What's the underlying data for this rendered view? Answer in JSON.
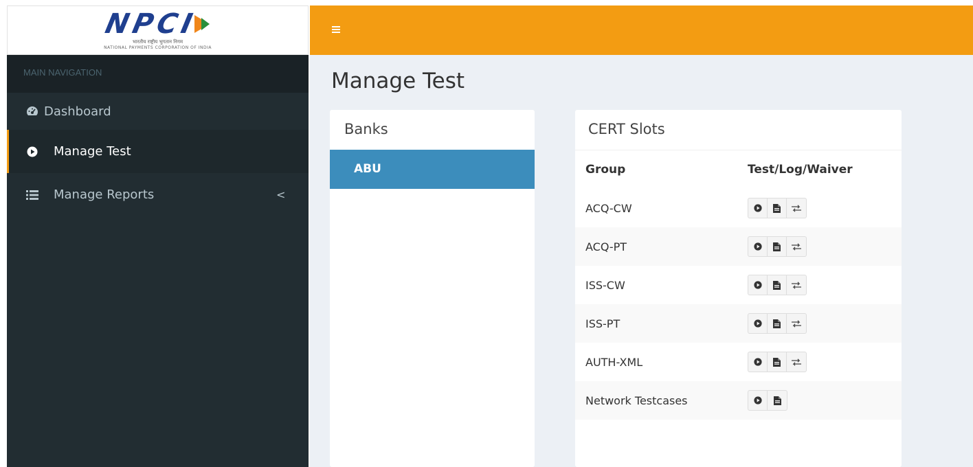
{
  "logo": {
    "brand": "NPCI",
    "subtitle_hindi": "भारतीय राष्ट्रीय भुगतान निगम",
    "subtitle_english": "NATIONAL PAYMENTS CORPORATION OF INDIA"
  },
  "colors": {
    "topbar": "#f39c12",
    "sidebar": "#222d32",
    "selected_bank": "#3c8dbc",
    "content_bg": "#ecf0f5"
  },
  "sidebar": {
    "header": "MAIN NAVIGATION",
    "items": [
      {
        "label": "Dashboard",
        "icon": "dashboard-icon"
      },
      {
        "label": "Manage Test",
        "icon": "play-circle-icon",
        "active": true
      },
      {
        "label": "Manage Reports",
        "icon": "list-icon",
        "chevron": "<"
      }
    ]
  },
  "page": {
    "title": "Manage Test"
  },
  "banks": {
    "title": "Banks",
    "items": [
      "ABU"
    ],
    "selected": "ABU"
  },
  "cert_slots": {
    "title": "CERT Slots",
    "columns": [
      "Group",
      "Test/Log/Waiver"
    ],
    "rows": [
      {
        "group": "ACQ-CW",
        "actions": [
          "play-icon",
          "file-icon",
          "exchange-icon"
        ]
      },
      {
        "group": "ACQ-PT",
        "actions": [
          "play-icon",
          "file-icon",
          "exchange-icon"
        ]
      },
      {
        "group": "ISS-CW",
        "actions": [
          "play-icon",
          "file-icon",
          "exchange-icon"
        ]
      },
      {
        "group": "ISS-PT",
        "actions": [
          "play-icon",
          "file-icon",
          "exchange-icon"
        ]
      },
      {
        "group": "AUTH-XML",
        "actions": [
          "play-icon",
          "file-icon",
          "exchange-icon"
        ]
      },
      {
        "group": "Network Testcases",
        "actions": [
          "play-icon",
          "file-icon"
        ]
      }
    ]
  }
}
